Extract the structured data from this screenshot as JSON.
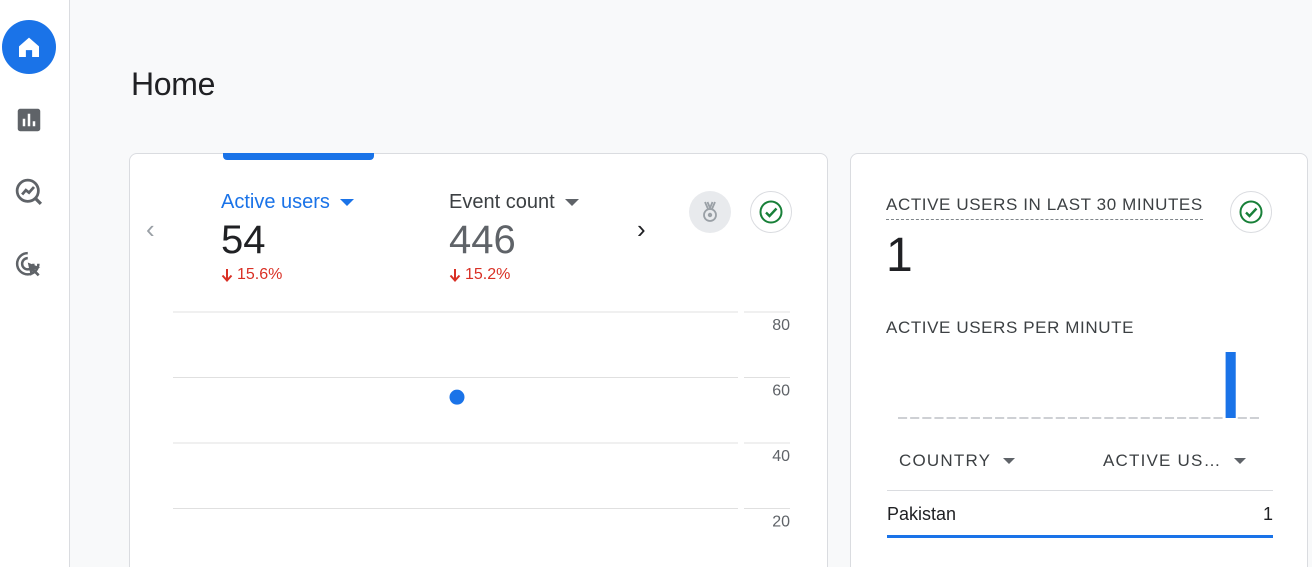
{
  "page": {
    "title": "Home"
  },
  "sidebar": {
    "items": [
      {
        "name": "home",
        "icon": "home-icon",
        "active": true
      },
      {
        "name": "reports",
        "icon": "bar-chart-icon",
        "active": false
      },
      {
        "name": "explore",
        "icon": "explore-icon",
        "active": false
      },
      {
        "name": "advertising",
        "icon": "target-cursor-icon",
        "active": false
      }
    ]
  },
  "overview": {
    "metrics": [
      {
        "label": "Active users",
        "value": "54",
        "change": "15.6%",
        "direction": "down"
      },
      {
        "label": "Event count",
        "value": "446",
        "change": "15.2%",
        "direction": "down"
      }
    ],
    "nav": {
      "prev": "‹",
      "next": "›"
    },
    "badges": [
      "medal-icon",
      "check-circle-icon"
    ]
  },
  "chart_data": {
    "type": "line",
    "y_ticks": [
      "80",
      "60",
      "40",
      "20"
    ],
    "ylim": [
      0,
      80
    ],
    "grid": true,
    "points": [
      {
        "y": 54
      }
    ]
  },
  "realtime": {
    "title": "ACTIVE USERS IN LAST 30 MINUTES",
    "value": "1",
    "subtitle": "ACTIVE USERS PER MINUTE",
    "per_minute": [
      0,
      0,
      0,
      0,
      0,
      0,
      0,
      0,
      0,
      0,
      0,
      0,
      0,
      0,
      0,
      0,
      0,
      0,
      0,
      0,
      0,
      0,
      0,
      0,
      0,
      0,
      0,
      1,
      0,
      0
    ],
    "table": {
      "columns": [
        "COUNTRY",
        "ACTIVE US…"
      ],
      "rows": [
        {
          "country": "Pakistan",
          "value": "1"
        }
      ]
    }
  },
  "colors": {
    "accent": "#1a73e8",
    "negative": "#d93025",
    "positive": "#188038"
  }
}
